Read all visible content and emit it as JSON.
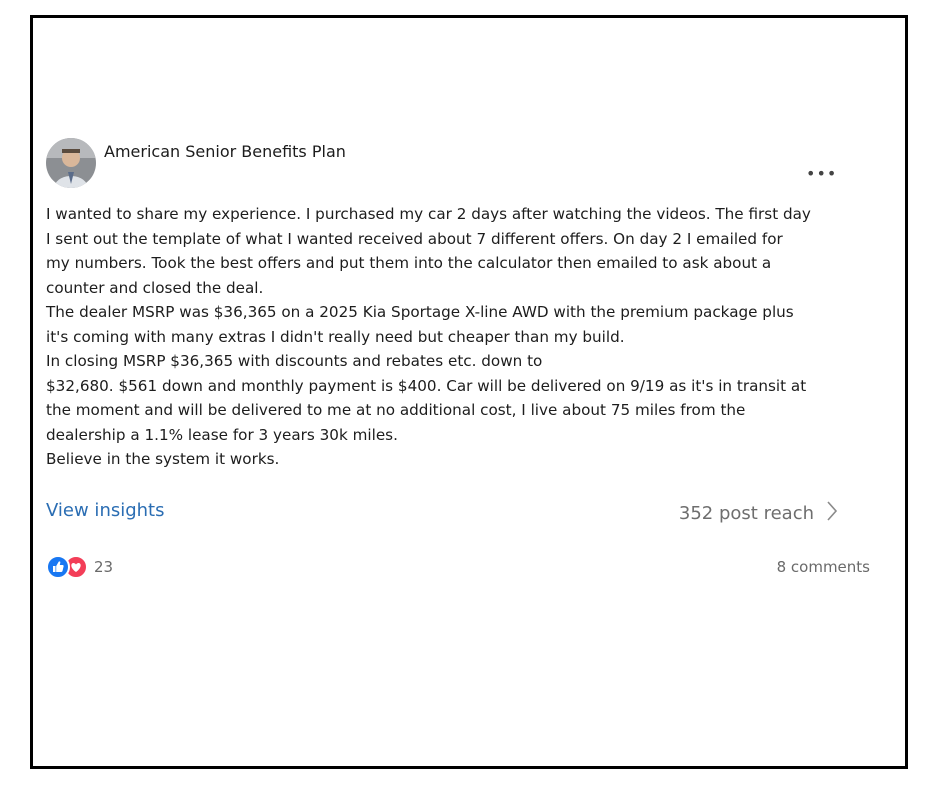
{
  "post": {
    "author": "American Senior Benefits Plan",
    "more_label": "•••",
    "lines": [
      "I wanted to share my experience. I purchased my car 2 days after watching the videos. The first day",
      "I sent out the  template of what I wanted received about 7 different offers. On day 2 I emailed for",
      "my numbers. Took the best offers and put them into the calculator then emailed to ask about a",
      "counter and closed the deal.",
      "The dealer MSRP was $36,365 on a 2025 Kia Sportage X-line AWD with the premium package plus",
      "it's coming with many extras I didn't really need  but cheaper than my build.",
      "In closing MSRP $36,365 with discounts and rebates etc. down to",
      "$32,680. $561 down and monthly payment is $400. Car will be delivered on 9/19 as it's in transit at",
      "the moment and will be delivered to me at no additional cost, I live about 75 miles from the",
      "dealership a 1.1% lease for 3 years 30k miles.",
      "Believe in the system it works."
    ]
  },
  "insights": {
    "link": "View insights",
    "reach": "352 post reach"
  },
  "engagement": {
    "reaction_count": "23",
    "comments": "8 comments",
    "icons": [
      "like-icon",
      "love-icon"
    ]
  },
  "colors": {
    "link": "#2a6db3",
    "like": "#1877f2",
    "love": "#f33e58"
  }
}
